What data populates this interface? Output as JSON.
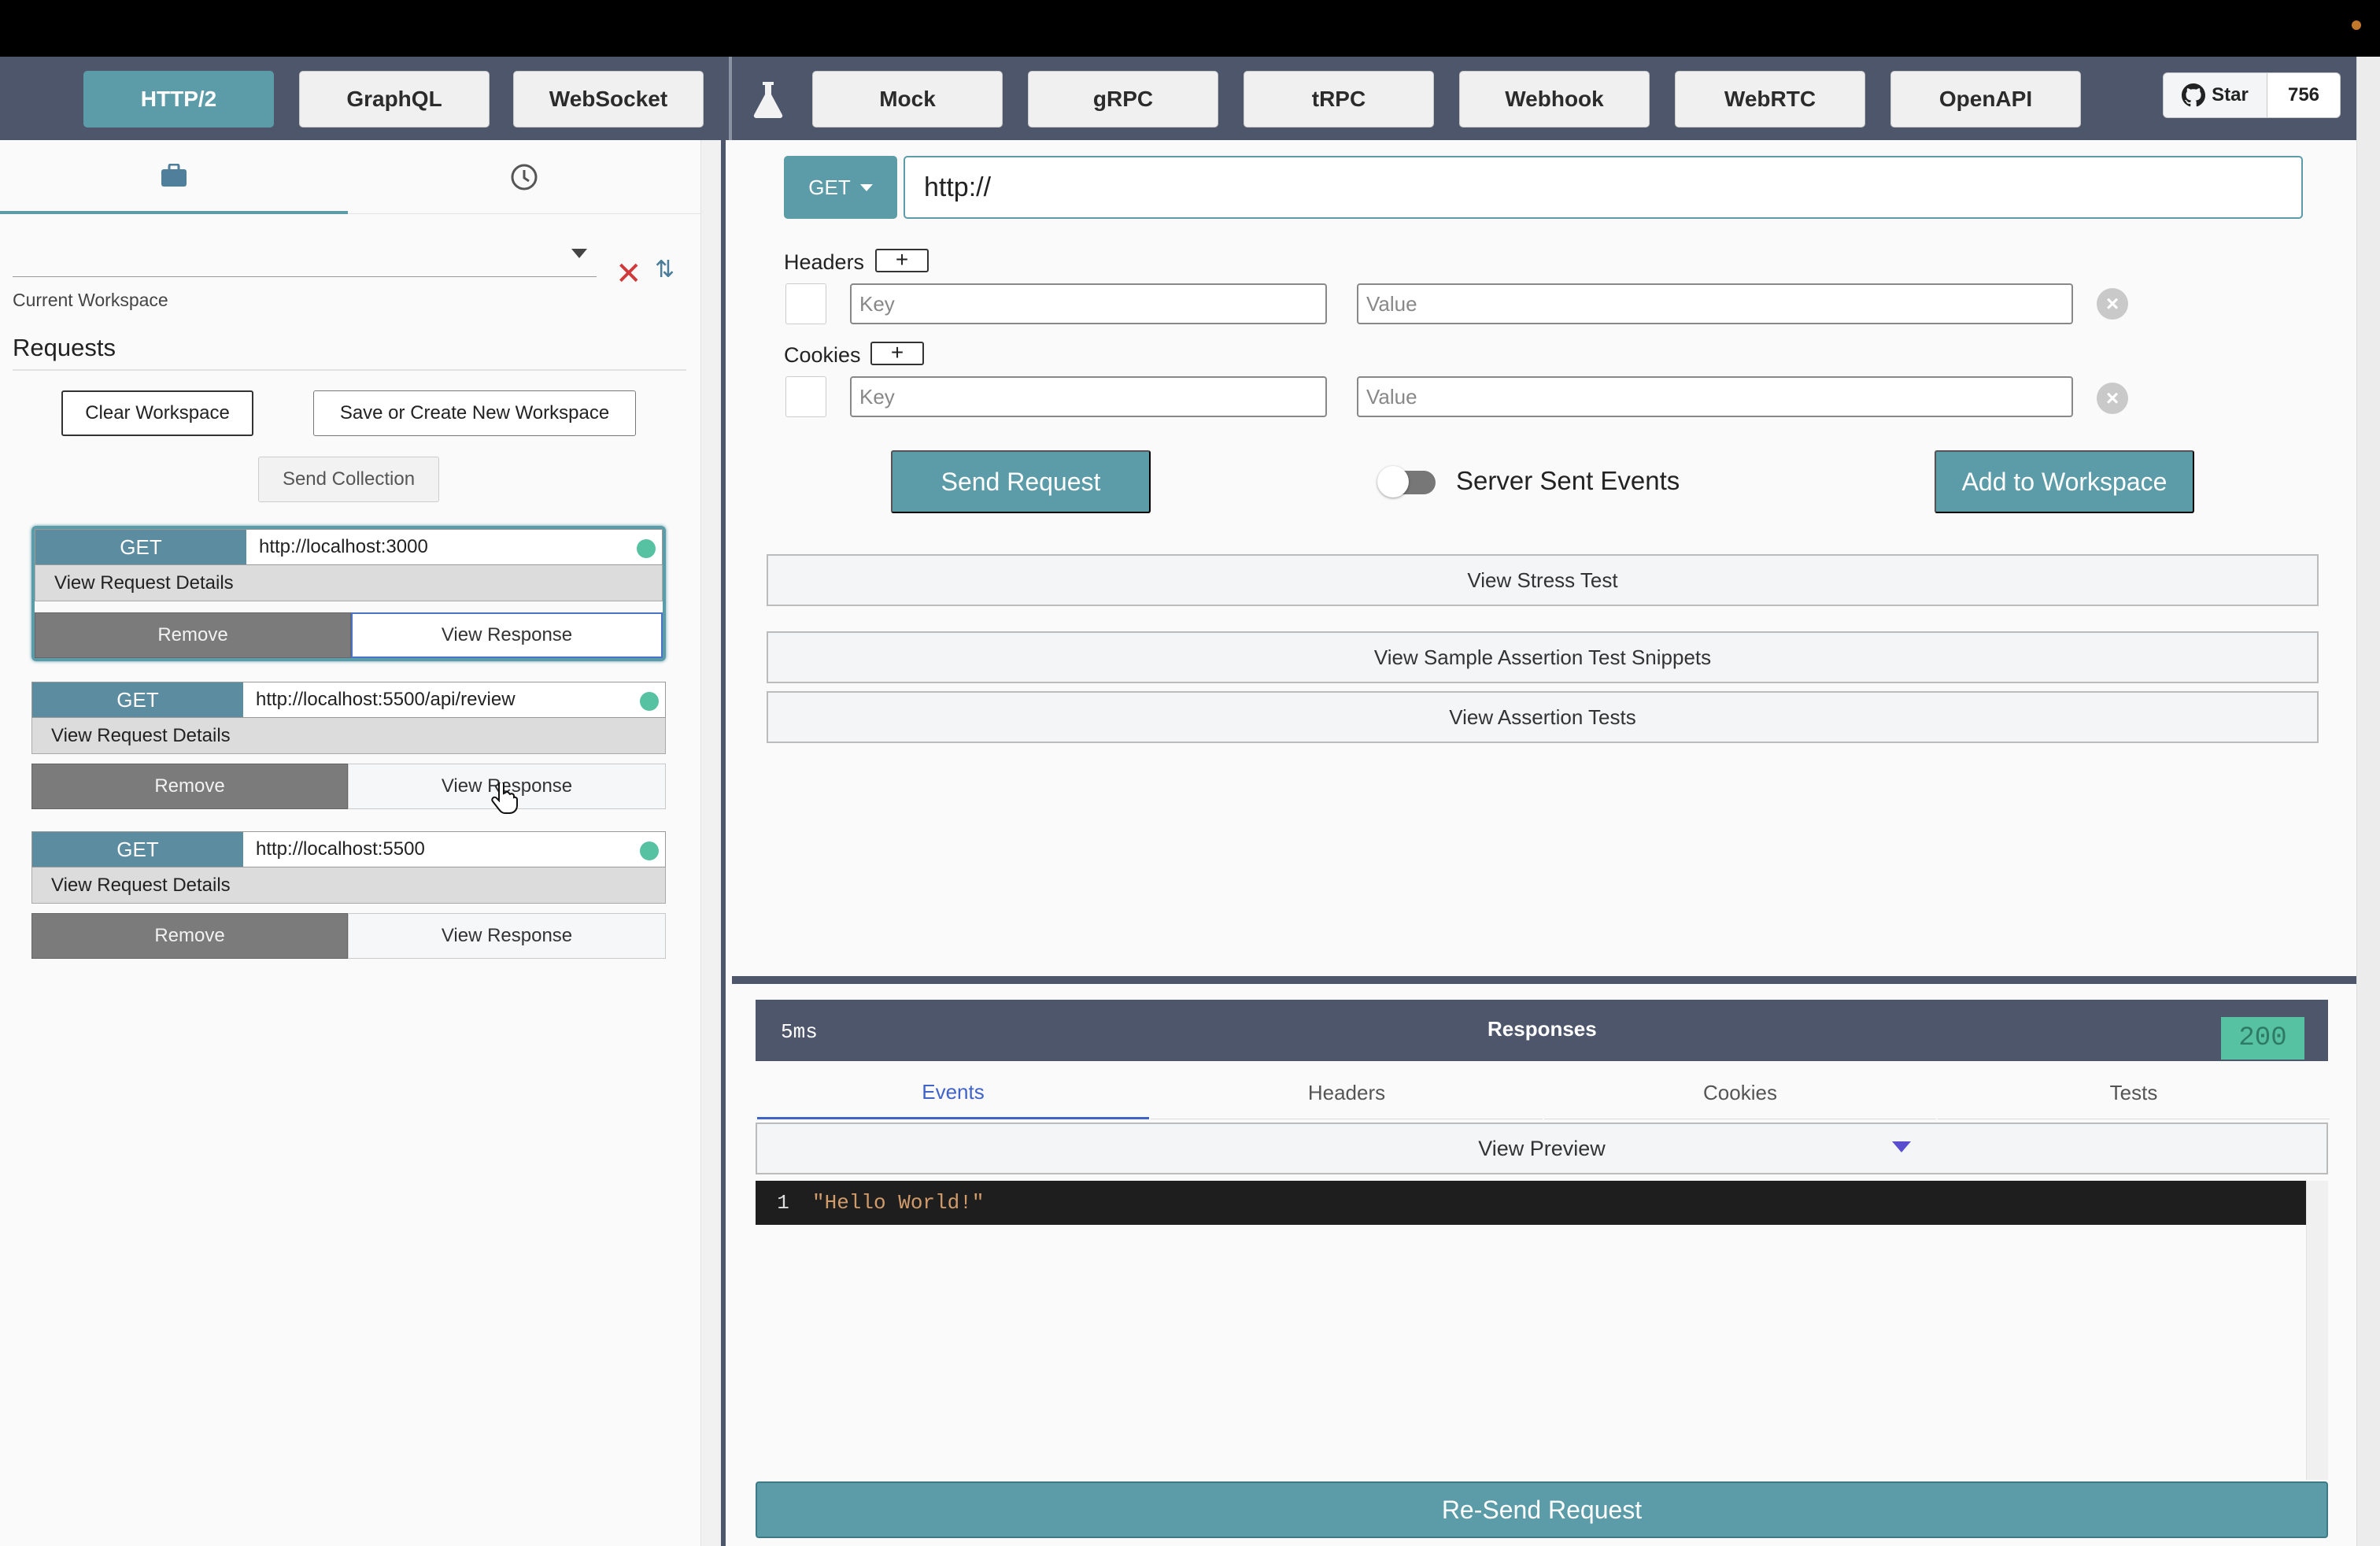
{
  "nav": {
    "left_tabs": [
      {
        "label": "HTTP/2",
        "active": true
      },
      {
        "label": "GraphQL",
        "active": false
      },
      {
        "label": "WebSocket",
        "active": false
      }
    ],
    "right_tabs": [
      {
        "label": "Mock"
      },
      {
        "label": "gRPC"
      },
      {
        "label": "tRPC"
      },
      {
        "label": "Webhook"
      },
      {
        "label": "WebRTC"
      },
      {
        "label": "OpenAPI"
      }
    ],
    "github": {
      "star_label": "Star",
      "count": "756"
    }
  },
  "sidebar": {
    "tabs": [
      {
        "icon": "briefcase-icon",
        "active": true
      },
      {
        "icon": "clock-icon",
        "active": false
      }
    ],
    "workspace_value": "",
    "workspace_label": "Current Workspace",
    "requests_title": "Requests",
    "clear_workspace": "Clear Workspace",
    "save_workspace": "Save or Create New Workspace",
    "send_collection": "Send Collection",
    "requests": [
      {
        "method": "GET",
        "url": "http://localhost:3000",
        "details": "View Request Details",
        "remove": "Remove",
        "view": "View Response",
        "selected": true
      },
      {
        "method": "GET",
        "url": "http://localhost:5500/api/review",
        "details": "View Request Details",
        "remove": "Remove",
        "view": "View Response",
        "selected": false
      },
      {
        "method": "GET",
        "url": "http://localhost:5500",
        "details": "View Request Details",
        "remove": "Remove",
        "view": "View Response",
        "selected": false
      }
    ]
  },
  "composer": {
    "method": "GET",
    "url": "http://",
    "headers_label": "Headers",
    "cookies_label": "Cookies",
    "add": "+",
    "key_placeholder": "Key",
    "value_placeholder": "Value",
    "send_request": "Send Request",
    "sse_label": "Server Sent Events",
    "add_to_workspace": "Add to Workspace",
    "view_stress_test": "View Stress Test",
    "view_snippets": "View Sample Assertion Test Snippets",
    "view_assertion_tests": "View Assertion Tests"
  },
  "responses": {
    "time": "5ms",
    "title": "Responses",
    "status": "200",
    "tabs": [
      "Events",
      "Headers",
      "Cookies",
      "Tests"
    ],
    "active_tab": "Events",
    "view_preview": "View Preview",
    "code": [
      {
        "line": "1",
        "text": "\"Hello World!\""
      }
    ],
    "resend": "Re-Send Request"
  },
  "colors": {
    "accent": "#5b9ca8",
    "nav_bg": "#4d566b",
    "status_green": "#56c2a2",
    "remove_gray": "#7b7b7b"
  }
}
